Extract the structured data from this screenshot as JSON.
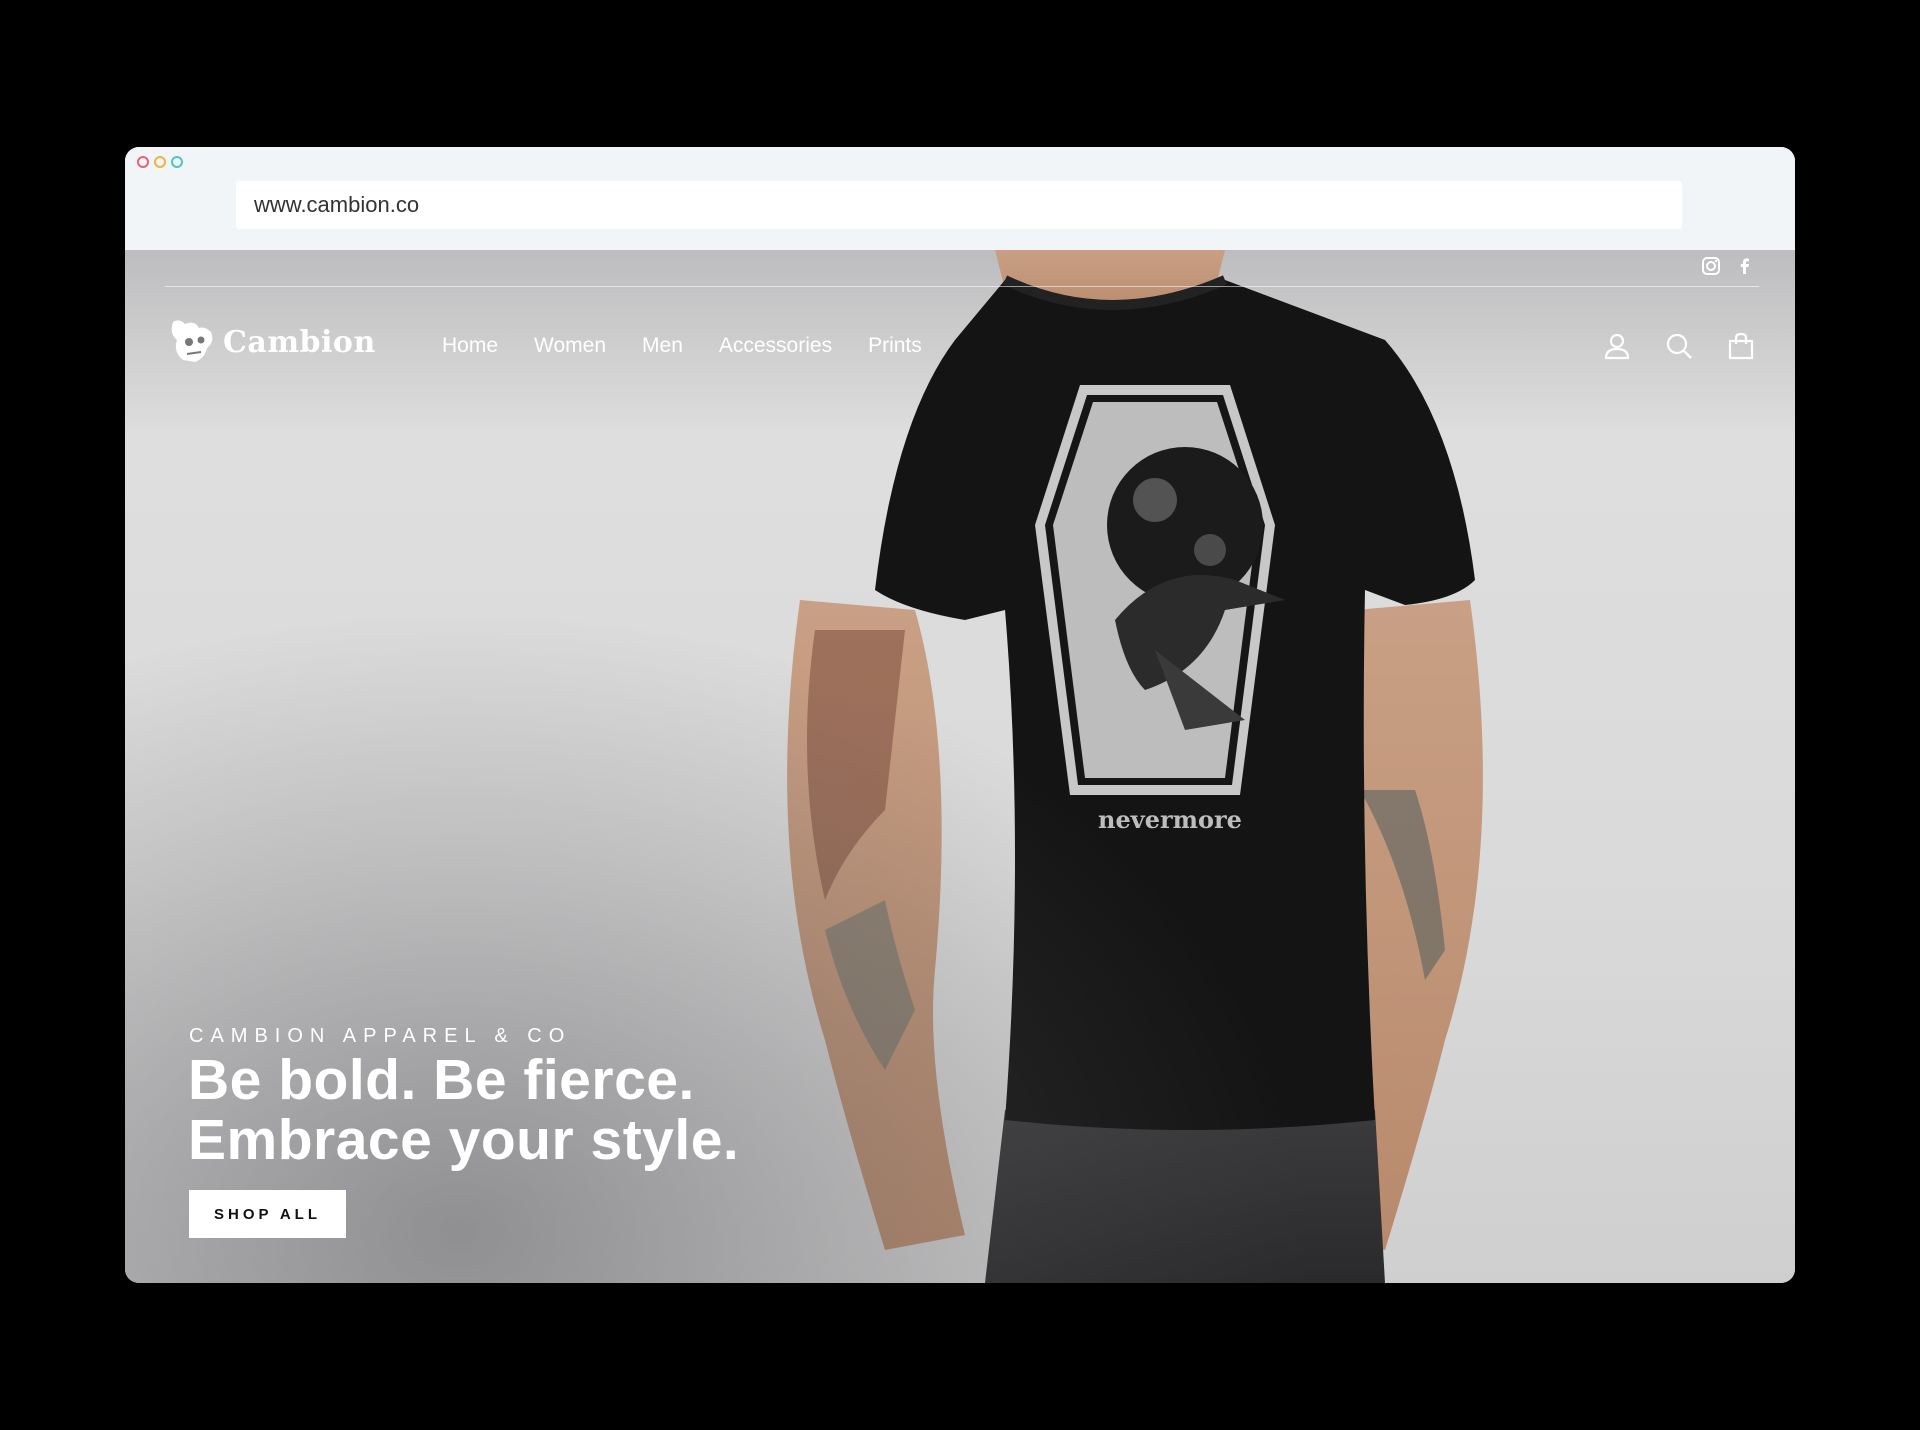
{
  "browser": {
    "url": "www.cambion.co"
  },
  "header": {
    "social": [
      "instagram-icon",
      "facebook-icon"
    ],
    "logo_text": "Cambion",
    "nav": [
      {
        "label": "Home"
      },
      {
        "label": "Women"
      },
      {
        "label": "Men"
      },
      {
        "label": "Accessories"
      },
      {
        "label": "Prints"
      }
    ],
    "actions": [
      "account-icon",
      "search-icon",
      "cart-icon"
    ]
  },
  "hero": {
    "eyebrow": "CAMBION APPAREL & CO",
    "headline": "Be bold. Be fierce.\nEmbrace your style.",
    "button_label": "SHOP ALL",
    "shirt_print_text": "nevermore"
  },
  "colors": {
    "background": "#000000",
    "chrome": "#f1f5f8",
    "shirt": "#141414",
    "text_light": "#ffffff"
  }
}
